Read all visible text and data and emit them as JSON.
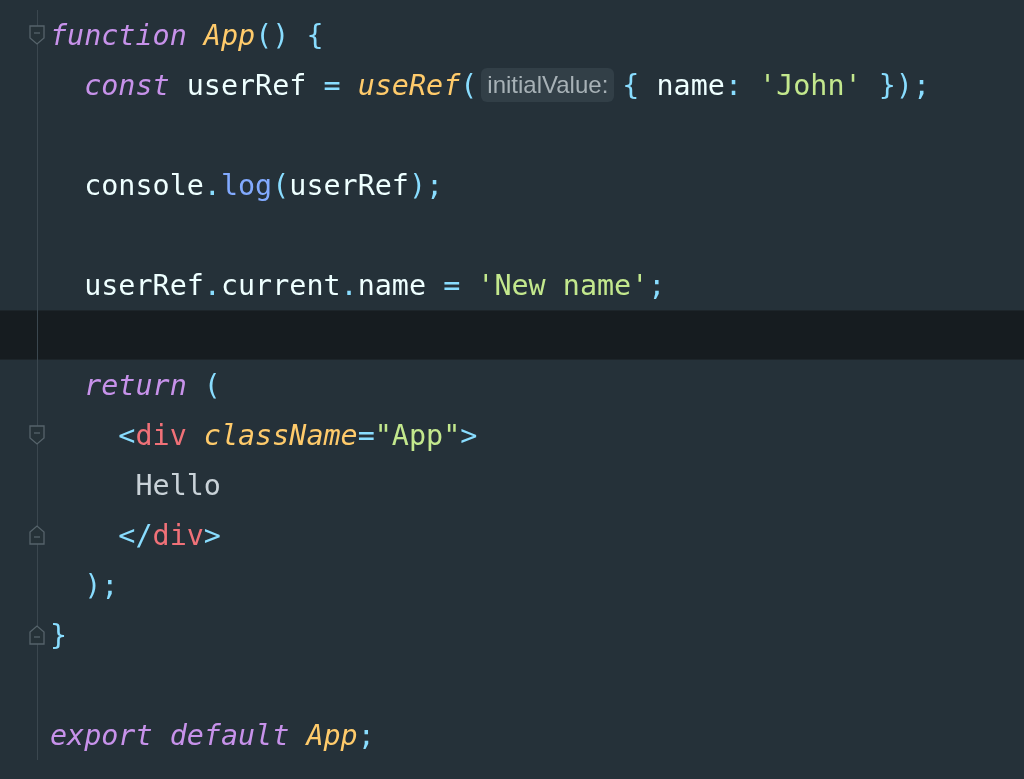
{
  "lines": [
    {
      "kind": "fold-start",
      "current": false,
      "tokens": [
        {
          "text": "function",
          "kind": "keyword"
        },
        {
          "text": " App",
          "kind": "name"
        },
        {
          "text": "()",
          "kind": "punct"
        },
        {
          "text": " {",
          "kind": "punct"
        }
      ]
    },
    {
      "kind": "plain",
      "current": false,
      "tokens": [
        {
          "text": "  const",
          "kind": "keyword"
        },
        {
          "text": " userRef",
          "kind": "plain"
        },
        {
          "text": " =",
          "kind": "punct"
        },
        {
          "text": " useRef",
          "kind": "name"
        },
        {
          "text": "(",
          "kind": "punct"
        },
        {
          "text": "initialValue:",
          "kind": "hint"
        },
        {
          "text": "{",
          "kind": "punct"
        },
        {
          "text": " name",
          "kind": "plain"
        },
        {
          "text": ":",
          "kind": "punct"
        },
        {
          "text": " 'John'",
          "kind": "string"
        },
        {
          "text": " });",
          "kind": "punct"
        }
      ]
    },
    {
      "kind": "plain",
      "current": false
    },
    {
      "kind": "plain",
      "current": false,
      "tokens": [
        {
          "text": "  console",
          "kind": "plain"
        },
        {
          "text": ".",
          "kind": "punct"
        },
        {
          "text": "log",
          "kind": "method"
        },
        {
          "text": "(",
          "kind": "punct"
        },
        {
          "text": "userRef",
          "kind": "plain"
        },
        {
          "text": ");",
          "kind": "punct"
        }
      ]
    },
    {
      "kind": "plain",
      "current": false
    },
    {
      "kind": "plain",
      "current": false,
      "tokens": [
        {
          "text": "  userRef",
          "kind": "plain"
        },
        {
          "text": ".",
          "kind": "punct"
        },
        {
          "text": "current",
          "kind": "plain"
        },
        {
          "text": ".",
          "kind": "punct"
        },
        {
          "text": "name",
          "kind": "plain"
        },
        {
          "text": " =",
          "kind": "punct"
        },
        {
          "text": " 'New name'",
          "kind": "string"
        },
        {
          "text": ";",
          "kind": "punct"
        }
      ]
    },
    {
      "kind": "plain",
      "current": true
    },
    {
      "kind": "plain",
      "current": false,
      "tokens": [
        {
          "text": "  return",
          "kind": "keyword"
        },
        {
          "text": " (",
          "kind": "punct"
        }
      ]
    },
    {
      "kind": "fold-start",
      "current": false,
      "tokens": [
        {
          "text": "    <",
          "kind": "punct"
        },
        {
          "text": "div",
          "kind": "tag"
        },
        {
          "text": " className",
          "kind": "attr"
        },
        {
          "text": "=",
          "kind": "punct"
        },
        {
          "text": "\"App\"",
          "kind": "string"
        },
        {
          "text": ">",
          "kind": "punct"
        }
      ]
    },
    {
      "kind": "plain",
      "current": false,
      "tokens": [
        {
          "text": "     Hello",
          "kind": "text"
        }
      ]
    },
    {
      "kind": "fold-end",
      "current": false,
      "tokens": [
        {
          "text": "    </",
          "kind": "punct"
        },
        {
          "text": "div",
          "kind": "tag"
        },
        {
          "text": ">",
          "kind": "punct"
        }
      ]
    },
    {
      "kind": "plain",
      "current": false,
      "tokens": [
        {
          "text": "  );",
          "kind": "punct"
        }
      ]
    },
    {
      "kind": "fold-end",
      "current": false,
      "tokens": [
        {
          "text": "}",
          "kind": "punct"
        }
      ]
    },
    {
      "kind": "plain",
      "current": false
    },
    {
      "kind": "plain",
      "current": false,
      "tokens": [
        {
          "text": "export",
          "kind": "keyword"
        },
        {
          "text": " default",
          "kind": "keyword"
        },
        {
          "text": " App",
          "kind": "name"
        },
        {
          "text": ";",
          "kind": "punct"
        }
      ]
    }
  ]
}
